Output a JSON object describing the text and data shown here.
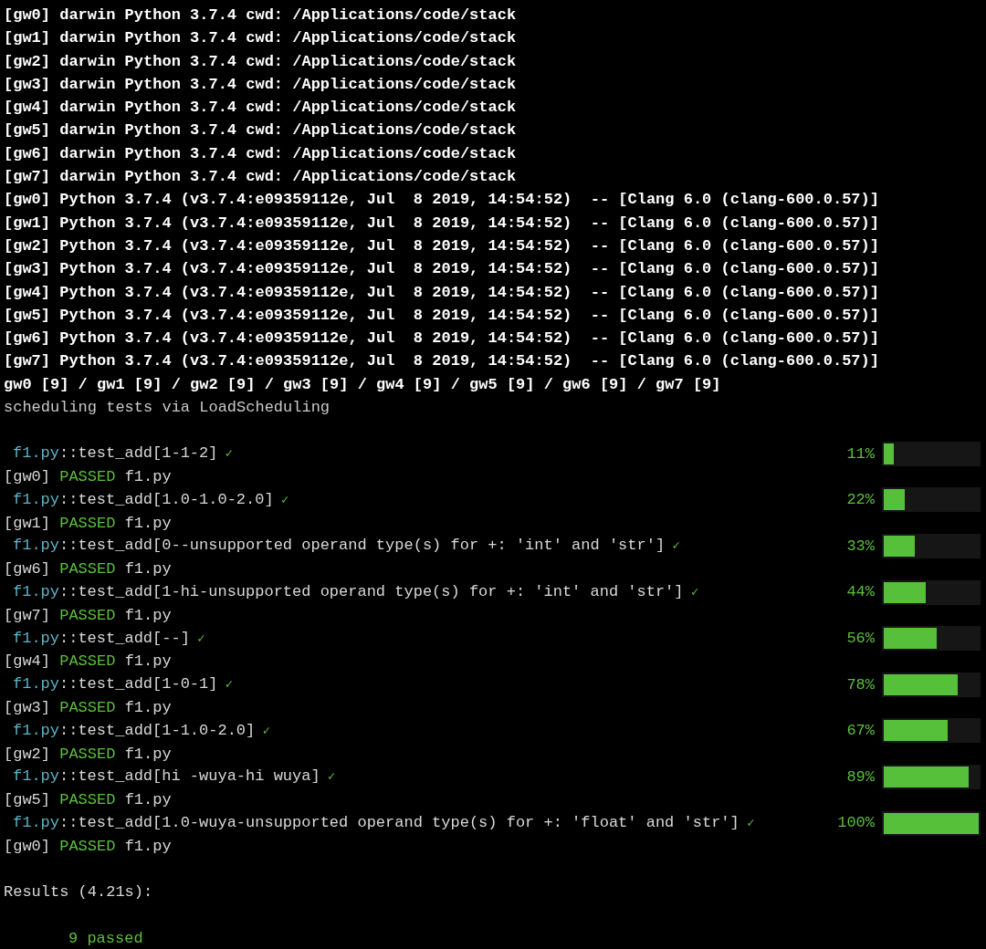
{
  "worker_info": [
    "[gw0] darwin Python 3.7.4 cwd: /Applications/code/stack",
    "[gw1] darwin Python 3.7.4 cwd: /Applications/code/stack",
    "[gw2] darwin Python 3.7.4 cwd: /Applications/code/stack",
    "[gw3] darwin Python 3.7.4 cwd: /Applications/code/stack",
    "[gw4] darwin Python 3.7.4 cwd: /Applications/code/stack",
    "[gw5] darwin Python 3.7.4 cwd: /Applications/code/stack",
    "[gw6] darwin Python 3.7.4 cwd: /Applications/code/stack",
    "[gw7] darwin Python 3.7.4 cwd: /Applications/code/stack",
    "[gw0] Python 3.7.4 (v3.7.4:e09359112e, Jul  8 2019, 14:54:52)  -- [Clang 6.0 (clang-600.0.57)]",
    "[gw1] Python 3.7.4 (v3.7.4:e09359112e, Jul  8 2019, 14:54:52)  -- [Clang 6.0 (clang-600.0.57)]",
    "[gw2] Python 3.7.4 (v3.7.4:e09359112e, Jul  8 2019, 14:54:52)  -- [Clang 6.0 (clang-600.0.57)]",
    "[gw3] Python 3.7.4 (v3.7.4:e09359112e, Jul  8 2019, 14:54:52)  -- [Clang 6.0 (clang-600.0.57)]",
    "[gw4] Python 3.7.4 (v3.7.4:e09359112e, Jul  8 2019, 14:54:52)  -- [Clang 6.0 (clang-600.0.57)]",
    "[gw5] Python 3.7.4 (v3.7.4:e09359112e, Jul  8 2019, 14:54:52)  -- [Clang 6.0 (clang-600.0.57)]",
    "[gw6] Python 3.7.4 (v3.7.4:e09359112e, Jul  8 2019, 14:54:52)  -- [Clang 6.0 (clang-600.0.57)]",
    "[gw7] Python 3.7.4 (v3.7.4:e09359112e, Jul  8 2019, 14:54:52)  -- [Clang 6.0 (clang-600.0.57)]",
    "gw0 [9] / gw1 [9] / gw2 [9] / gw3 [9] / gw4 [9] / gw5 [9] / gw6 [9] / gw7 [9]"
  ],
  "scheduling_line": "scheduling tests via LoadScheduling",
  "tests": [
    {
      "module": "f1.py",
      "test": "::test_add[1-1-2]",
      "check": "✓",
      "percent": "11%",
      "level": 0.11,
      "worker": "[gw0]",
      "status": "PASSED",
      "file": "f1.py"
    },
    {
      "module": "f1.py",
      "test": "::test_add[1.0-1.0-2.0]",
      "check": "✓",
      "percent": "22%",
      "level": 0.22,
      "worker": "[gw1]",
      "status": "PASSED",
      "file": "f1.py"
    },
    {
      "module": "f1.py",
      "test": "::test_add[0--unsupported operand type(s) for +: 'int' and 'str']",
      "check": "✓",
      "percent": "33%",
      "level": 0.33,
      "worker": "[gw6]",
      "status": "PASSED",
      "file": "f1.py"
    },
    {
      "module": "f1.py",
      "test": "::test_add[1-hi-unsupported operand type(s) for +: 'int' and 'str']",
      "check": "✓",
      "percent": "44%",
      "level": 0.44,
      "worker": "[gw7]",
      "status": "PASSED",
      "file": "f1.py"
    },
    {
      "module": "f1.py",
      "test": "::test_add[--]",
      "check": "✓",
      "percent": "56%",
      "level": 0.56,
      "worker": "[gw4]",
      "status": "PASSED",
      "file": "f1.py"
    },
    {
      "module": "f1.py",
      "test": "::test_add[1-0-1]",
      "check": "✓",
      "percent": "78%",
      "level": 0.78,
      "worker": "[gw3]",
      "status": "PASSED",
      "file": "f1.py"
    },
    {
      "module": "f1.py",
      "test": "::test_add[1-1.0-2.0]",
      "check": "✓",
      "percent": "67%",
      "level": 0.67,
      "worker": "[gw2]",
      "status": "PASSED",
      "file": "f1.py"
    },
    {
      "module": "f1.py",
      "test": "::test_add[hi -wuya-hi wuya]",
      "check": "✓",
      "percent": "89%",
      "level": 0.89,
      "worker": "[gw5]",
      "status": "PASSED",
      "file": "f1.py"
    },
    {
      "module": "f1.py",
      "test": "::test_add[1.0-wuya-unsupported operand type(s) for +: 'float' and 'str']",
      "check": "✓",
      "percent": "100%",
      "level": 1,
      "worker": "[gw0]",
      "status": "PASSED",
      "file": "f1.py"
    }
  ],
  "results": {
    "title": "Results (4.21s):",
    "summary": "9 passed"
  }
}
